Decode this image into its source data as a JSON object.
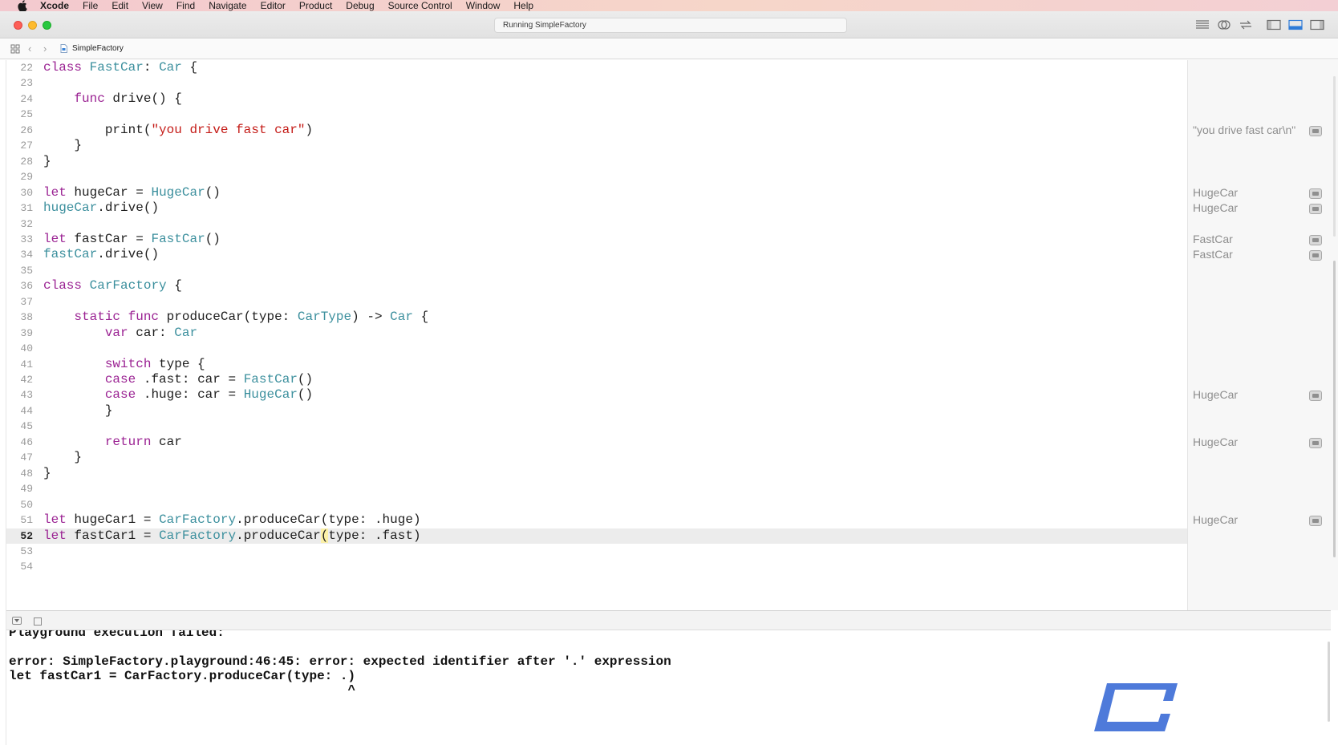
{
  "menubar": {
    "app_name": "Xcode",
    "items": [
      "File",
      "Edit",
      "View",
      "Find",
      "Navigate",
      "Editor",
      "Product",
      "Debug",
      "Source Control",
      "Window",
      "Help"
    ]
  },
  "window": {
    "activity_status": "Running SimpleFactory"
  },
  "jumpbar": {
    "file_label": "SimpleFactory"
  },
  "editor": {
    "current_line": 52,
    "lines": [
      {
        "n": "22",
        "code": "class FastCar: Car {"
      },
      {
        "n": "23",
        "code": ""
      },
      {
        "n": "24",
        "code": "    func drive() {"
      },
      {
        "n": "25",
        "code": ""
      },
      {
        "n": "26",
        "code": "        print(\"you drive fast car\")"
      },
      {
        "n": "27",
        "code": "    }"
      },
      {
        "n": "28",
        "code": "}"
      },
      {
        "n": "29",
        "code": ""
      },
      {
        "n": "30",
        "code": "let hugeCar = HugeCar()"
      },
      {
        "n": "31",
        "code": "hugeCar.drive()"
      },
      {
        "n": "32",
        "code": ""
      },
      {
        "n": "33",
        "code": "let fastCar = FastCar()"
      },
      {
        "n": "34",
        "code": "fastCar.drive()"
      },
      {
        "n": "35",
        "code": ""
      },
      {
        "n": "36",
        "code": "class CarFactory {"
      },
      {
        "n": "37",
        "code": ""
      },
      {
        "n": "38",
        "code": "    static func produceCar(type: CarType) -> Car {"
      },
      {
        "n": "39",
        "code": "        var car: Car"
      },
      {
        "n": "40",
        "code": ""
      },
      {
        "n": "41",
        "code": "        switch type {"
      },
      {
        "n": "42",
        "code": "        case .fast: car = FastCar()"
      },
      {
        "n": "43",
        "code": "        case .huge: car = HugeCar()"
      },
      {
        "n": "44",
        "code": "        }"
      },
      {
        "n": "45",
        "code": ""
      },
      {
        "n": "46",
        "code": "        return car"
      },
      {
        "n": "47",
        "code": "    }"
      },
      {
        "n": "48",
        "code": "}"
      },
      {
        "n": "49",
        "code": ""
      },
      {
        "n": "50",
        "code": ""
      },
      {
        "n": "51",
        "code": "let hugeCar1 = CarFactory.produceCar(type: .huge)"
      },
      {
        "n": "52",
        "code": "let fastCar1 = CarFactory.produceCar(type: .fast)"
      },
      {
        "n": "53",
        "code": ""
      },
      {
        "n": "54",
        "code": ""
      }
    ]
  },
  "results": [
    {
      "line": "26",
      "text": "\"you drive fast car\\n\""
    },
    {
      "line": "30",
      "text": "HugeCar"
    },
    {
      "line": "31",
      "text": "HugeCar"
    },
    {
      "line": "33",
      "text": "FastCar"
    },
    {
      "line": "34",
      "text": "FastCar"
    },
    {
      "line": "43",
      "text": "HugeCar"
    },
    {
      "line": "46",
      "text": "HugeCar"
    },
    {
      "line": "51",
      "text": "HugeCar"
    }
  ],
  "console": {
    "lines": [
      "Playground execution failed:",
      "",
      "error: SimpleFactory.playground:46:45: error: expected identifier after '.' expression",
      "let fastCar1 = CarFactory.produceCar(type: .)",
      "                                            ^"
    ]
  },
  "icons": {
    "apple": "apple-logo-icon",
    "navigator_toggle": "navigator-toggle-icon",
    "debug_toggle": "debug-area-toggle-icon",
    "inspector_toggle": "inspector-toggle-icon",
    "standard_editor": "standard-editor-icon",
    "assistant_editor": "assistant-editor-icon",
    "version_editor": "version-editor-icon"
  },
  "colors": {
    "keyword": "#9b2393",
    "type": "#3b8f9d",
    "string": "#c41a16",
    "current_line": "#ececec",
    "results_text": "#8e8e8e"
  }
}
